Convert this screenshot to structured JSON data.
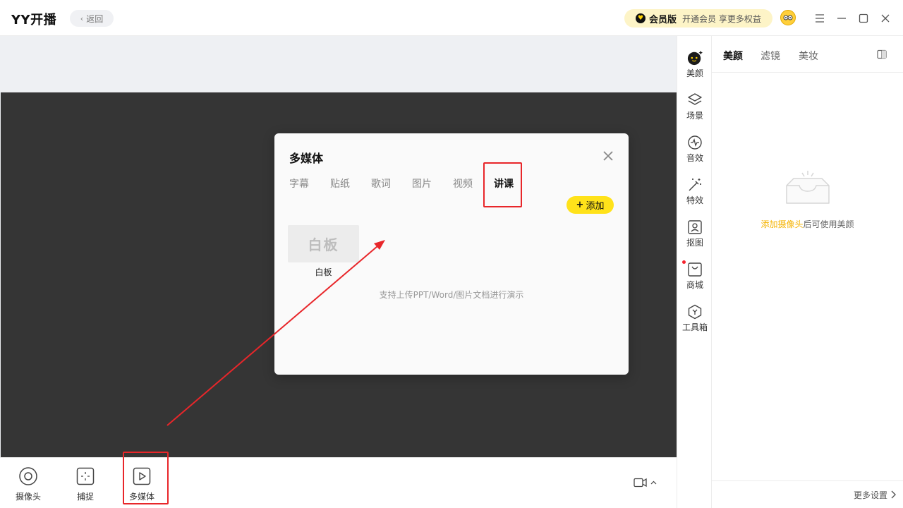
{
  "titlebar": {
    "app_title": "YY开播",
    "back_label": "返回",
    "vip_label": "会员版",
    "vip_desc": "开通会员 享更多权益"
  },
  "bottombar": {
    "tools": [
      {
        "label": "摄像头",
        "icon": "camera-circle-icon"
      },
      {
        "label": "捕捉",
        "icon": "capture-icon"
      },
      {
        "label": "多媒体",
        "icon": "play-icon"
      }
    ]
  },
  "rail": {
    "items": [
      {
        "label": "美颜",
        "icon": "beauty-face-icon"
      },
      {
        "label": "场景",
        "icon": "layers-icon"
      },
      {
        "label": "音效",
        "icon": "sound-wave-icon"
      },
      {
        "label": "特效",
        "icon": "magic-wand-icon"
      },
      {
        "label": "抠图",
        "icon": "portrait-cutout-icon"
      },
      {
        "label": "商城",
        "icon": "shopping-bag-icon"
      },
      {
        "label": "工具箱",
        "icon": "toolbox-icon"
      }
    ]
  },
  "panel": {
    "tabs": [
      "美颜",
      "滤镜",
      "美妆"
    ],
    "empty_link": "添加摄像头",
    "empty_rest": "后可使用美颜",
    "more_settings": "更多设置"
  },
  "modal": {
    "title": "多媒体",
    "tabs": [
      "字幕",
      "贴纸",
      "歌词",
      "图片",
      "视频",
      "讲课"
    ],
    "add_label": "添加",
    "whiteboard_thumb": "白板",
    "whiteboard_label": "白板",
    "hint": "支持上传PPT/Word/图片文档进行演示"
  },
  "colors": {
    "accent_yellow": "#ffe21a",
    "highlight_red": "#e8262a",
    "link_orange": "#f5b300"
  }
}
